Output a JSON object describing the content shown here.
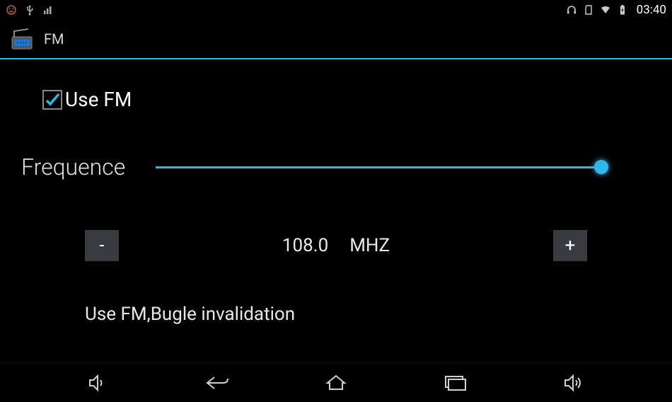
{
  "status": {
    "time": "03:40"
  },
  "header": {
    "title": "FM"
  },
  "checkbox": {
    "label": "Use FM",
    "checked": true
  },
  "frequency": {
    "label": "Frequence",
    "value": "108.0",
    "unit": "MHZ",
    "decrement": "-",
    "increment": "+"
  },
  "hint": "Use FM,Bugle invalidation"
}
